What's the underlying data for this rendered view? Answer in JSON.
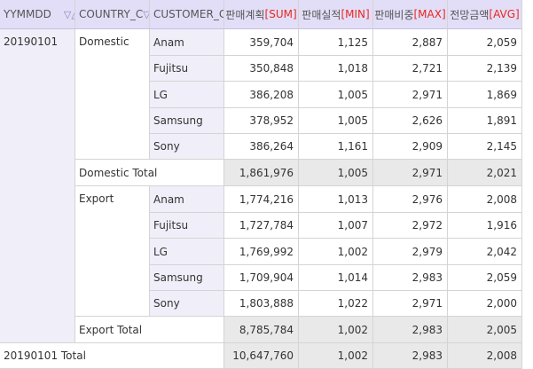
{
  "headers": {
    "yymmdd": "YYMMDD",
    "country": "COUNTRY_C",
    "customer": "CUSTOMER_C",
    "m1_label": "판매계획",
    "m1_agg": "[SUM]",
    "m2_label": "판매실적",
    "m2_agg": "[MIN]",
    "m3_label": "판매비중",
    "m3_agg": "[MAX]",
    "m4_label": "전망금액",
    "m4_agg": "[AVG]",
    "filter_glyph": "▽",
    "sort_glyph": "△"
  },
  "date": "20190101",
  "groups": [
    {
      "country": "Domestic",
      "rows": [
        {
          "customer": "Anam",
          "m1": "359,704",
          "m2": "1,125",
          "m3": "2,887",
          "m4": "2,059"
        },
        {
          "customer": "Fujitsu",
          "m1": "350,848",
          "m2": "1,018",
          "m3": "2,721",
          "m4": "2,139"
        },
        {
          "customer": "LG",
          "m1": "386,208",
          "m2": "1,005",
          "m3": "2,971",
          "m4": "1,869"
        },
        {
          "customer": "Samsung",
          "m1": "378,952",
          "m2": "1,005",
          "m3": "2,626",
          "m4": "1,891"
        },
        {
          "customer": "Sony",
          "m1": "386,264",
          "m2": "1,161",
          "m3": "2,909",
          "m4": "2,145"
        }
      ],
      "total": {
        "label": "Domestic Total",
        "m1": "1,861,976",
        "m2": "1,005",
        "m3": "2,971",
        "m4": "2,021"
      }
    },
    {
      "country": "Export",
      "rows": [
        {
          "customer": "Anam",
          "m1": "1,774,216",
          "m2": "1,013",
          "m3": "2,976",
          "m4": "2,008"
        },
        {
          "customer": "Fujitsu",
          "m1": "1,727,784",
          "m2": "1,007",
          "m3": "2,972",
          "m4": "1,916"
        },
        {
          "customer": "LG",
          "m1": "1,769,992",
          "m2": "1,002",
          "m3": "2,979",
          "m4": "2,042"
        },
        {
          "customer": "Samsung",
          "m1": "1,709,904",
          "m2": "1,014",
          "m3": "2,983",
          "m4": "2,059"
        },
        {
          "customer": "Sony",
          "m1": "1,803,888",
          "m2": "1,022",
          "m3": "2,971",
          "m4": "2,000"
        }
      ],
      "total": {
        "label": "Export Total",
        "m1": "8,785,784",
        "m2": "1,002",
        "m3": "2,983",
        "m4": "2,005"
      }
    }
  ],
  "grand_total": {
    "label": "20190101 Total",
    "m1": "10,647,760",
    "m2": "1,002",
    "m3": "2,983",
    "m4": "2,008"
  }
}
